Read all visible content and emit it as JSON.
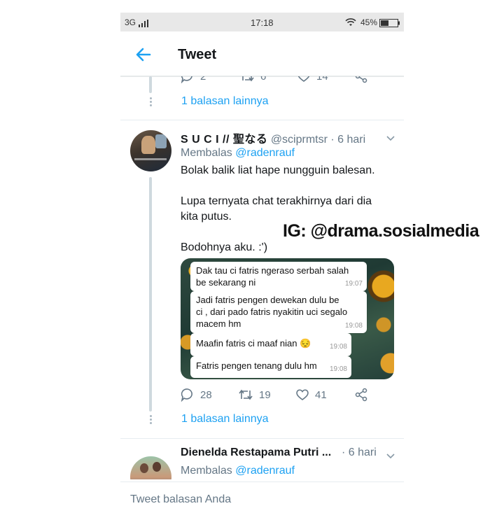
{
  "status_bar": {
    "network": "3G",
    "time": "17:18",
    "battery": "45%"
  },
  "header": {
    "title": "Tweet"
  },
  "prev_tweet_actions": {
    "replies": "2",
    "retweets": "6",
    "likes": "14"
  },
  "more_replies_1": "1 balasan lainnya",
  "tweet1": {
    "name": "S U C I // 聖なる",
    "handle": "@sciprmtsr",
    "time": "· 6 hari",
    "replying_prefix": "Membalas",
    "replying_to": "@radenrauf",
    "text_lines": [
      "Bolak balik liat hape nungguin balesan.",
      "Lupa ternyata chat terakhirnya dari dia",
      "kita putus.",
      "Bodohnya aku. :')"
    ],
    "chat": [
      {
        "line1": "Dak tau ci fatris ngeraso serbah salah",
        "line2": "be sekarang ni",
        "time": "19:07"
      },
      {
        "line1": "Jadi fatris pengen dewekan dulu be",
        "line2": "ci , dari pado fatris nyakitin uci segalo",
        "line3": "macem hm",
        "time": "19:08"
      },
      {
        "line1": "Maafin fatris ci maaf nian 😔",
        "time": "19:08"
      },
      {
        "line1": "Fatris pengen tenang dulu hm",
        "time": "19:08"
      }
    ],
    "actions": {
      "replies": "28",
      "retweets": "19",
      "likes": "41"
    }
  },
  "more_replies_2": "1 balasan lainnya",
  "tweet2": {
    "name": "Dienelda Restapama Putri ...",
    "time": "· 6 hari",
    "replying_prefix": "Membalas",
    "replying_to": "@radenrauf"
  },
  "reply_box": {
    "placeholder": "Tweet balasan Anda"
  },
  "watermark": "IG: @drama.sosialmedia",
  "colors": {
    "accent": "#1da1f2",
    "secondary_text": "#657786"
  }
}
